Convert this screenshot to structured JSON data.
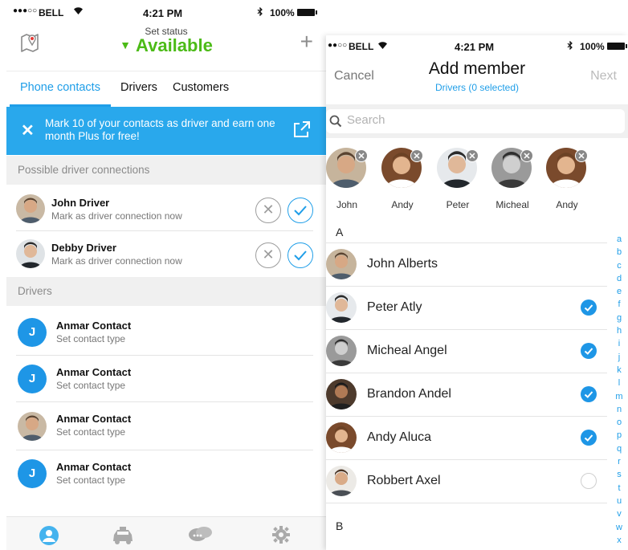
{
  "left": {
    "status_bar": {
      "carrier": "BELL",
      "time": "4:21 PM",
      "battery": "100%"
    },
    "header": {
      "set_status_label": "Set status",
      "status_value": "Available"
    },
    "tabs": [
      {
        "label": "Phone contacts",
        "active": true
      },
      {
        "label": "Drivers",
        "active": false
      },
      {
        "label": "Customers",
        "active": false
      }
    ],
    "promo": {
      "text": "Mark 10 of your contacts as driver and earn one month Plus for free!"
    },
    "sections": {
      "possible": "Possible driver connections",
      "drivers": "Drivers"
    },
    "possible_connections": [
      {
        "name": "John Driver",
        "subtitle": "Mark as driver connection now"
      },
      {
        "name": "Debby Driver",
        "subtitle": "Mark as driver connection now"
      }
    ],
    "drivers": [
      {
        "name": "Anmar Contact",
        "subtitle": "Set contact type",
        "avatar": "letter",
        "initial": "J"
      },
      {
        "name": "Anmar Contact",
        "subtitle": "Set contact type",
        "avatar": "letter",
        "initial": "J"
      },
      {
        "name": "Anmar Contact",
        "subtitle": "Set contact type",
        "avatar": "photo"
      },
      {
        "name": "Anmar Contact",
        "subtitle": "Set contact type",
        "avatar": "letter",
        "initial": "J"
      }
    ],
    "tab_bar": [
      "contacts-icon",
      "taxi-icon",
      "chat-icon",
      "settings-icon"
    ]
  },
  "right": {
    "status_bar": {
      "carrier": "BELL",
      "time": "4:21 PM",
      "battery": "100%"
    },
    "header": {
      "cancel_label": "Cancel",
      "title": "Add member",
      "subtitle": "Drivers (0 selected)",
      "next_label": "Next"
    },
    "search": {
      "placeholder": "Search"
    },
    "selected_members": [
      {
        "name": "John"
      },
      {
        "name": "Andy"
      },
      {
        "name": "Peter"
      },
      {
        "name": "Micheal"
      },
      {
        "name": "Andy"
      }
    ],
    "sections": [
      "A",
      "B"
    ],
    "members": [
      {
        "name": "John Alberts",
        "selected": null
      },
      {
        "name": "Peter Atly",
        "selected": true
      },
      {
        "name": "Micheal Angel",
        "selected": true
      },
      {
        "name": "Brandon Andel",
        "selected": true
      },
      {
        "name": "Andy Aluca",
        "selected": true
      },
      {
        "name": "Robbert Axel",
        "selected": false
      }
    ],
    "alpha_index": [
      "a",
      "b",
      "c",
      "d",
      "e",
      "f",
      "g",
      "h",
      "i",
      "j",
      "k",
      "l",
      "m",
      "n",
      "o",
      "p",
      "q",
      "r",
      "s",
      "t",
      "u",
      "v",
      "w",
      "x"
    ]
  },
  "colors": {
    "accent": "#1f9ee8",
    "available": "#4cbb17",
    "promo_bg": "#29a8ec",
    "section_bg": "#f0f0f0"
  }
}
